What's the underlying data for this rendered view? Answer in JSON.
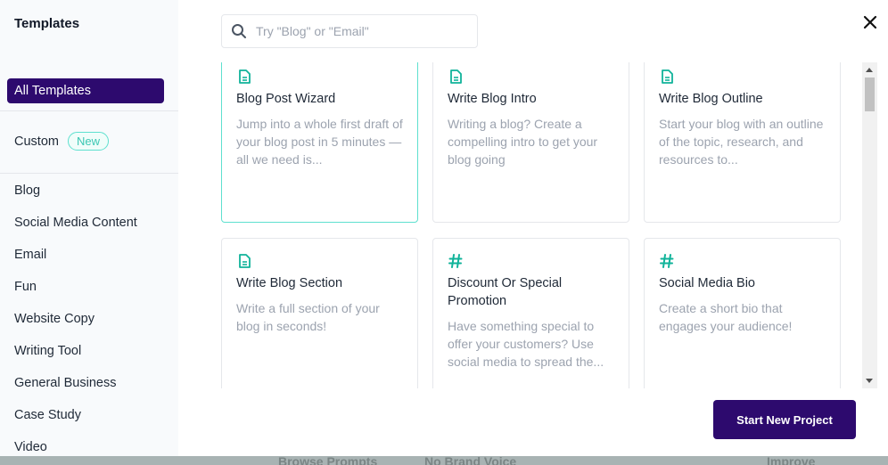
{
  "sidebar": {
    "title": "Templates",
    "active_item": "All Templates",
    "custom": {
      "label": "Custom",
      "badge": "New"
    },
    "items": [
      {
        "label": "Blog"
      },
      {
        "label": "Social Media Content"
      },
      {
        "label": "Email"
      },
      {
        "label": "Fun"
      },
      {
        "label": "Website Copy"
      },
      {
        "label": "Writing Tool"
      },
      {
        "label": "General Business"
      },
      {
        "label": "Case Study"
      },
      {
        "label": "Video"
      }
    ]
  },
  "search": {
    "placeholder": "Try \"Blog\" or \"Email\"",
    "value": ""
  },
  "cards": [
    {
      "title": "Blog Post Wizard",
      "description": "Jump into a whole first draft of your blog post in 5 minutes — all we need is...",
      "icon": "document-icon"
    },
    {
      "title": "Write Blog Intro",
      "description": "Writing a blog? Create a compelling intro to get your blog going",
      "icon": "document-icon"
    },
    {
      "title": "Write Blog Outline",
      "description": "Start your blog with an outline of the topic, research, and resources to...",
      "icon": "document-icon"
    },
    {
      "title": "Write Blog Section",
      "description": "Write a full section of your blog in seconds!",
      "icon": "document-icon"
    },
    {
      "title": "Discount Or Special Promotion",
      "description": "Have something special to offer your customers? Use social media to spread the...",
      "icon": "hash-icon"
    },
    {
      "title": "Social Media Bio",
      "description": "Create a short bio that engages your audience!",
      "icon": "hash-icon"
    }
  ],
  "cta": {
    "label": "Start New Project"
  },
  "background": {
    "browse_prompts": "Browse Prompts",
    "brand_voice": "No Brand Voice",
    "improve": "Improve"
  },
  "colors": {
    "primary": "#2d0a6e",
    "accent": "#10b39a",
    "accent_light": "#5ee0cf",
    "muted_text": "#9ca3af",
    "sidebar_bg": "#f8fafc"
  }
}
